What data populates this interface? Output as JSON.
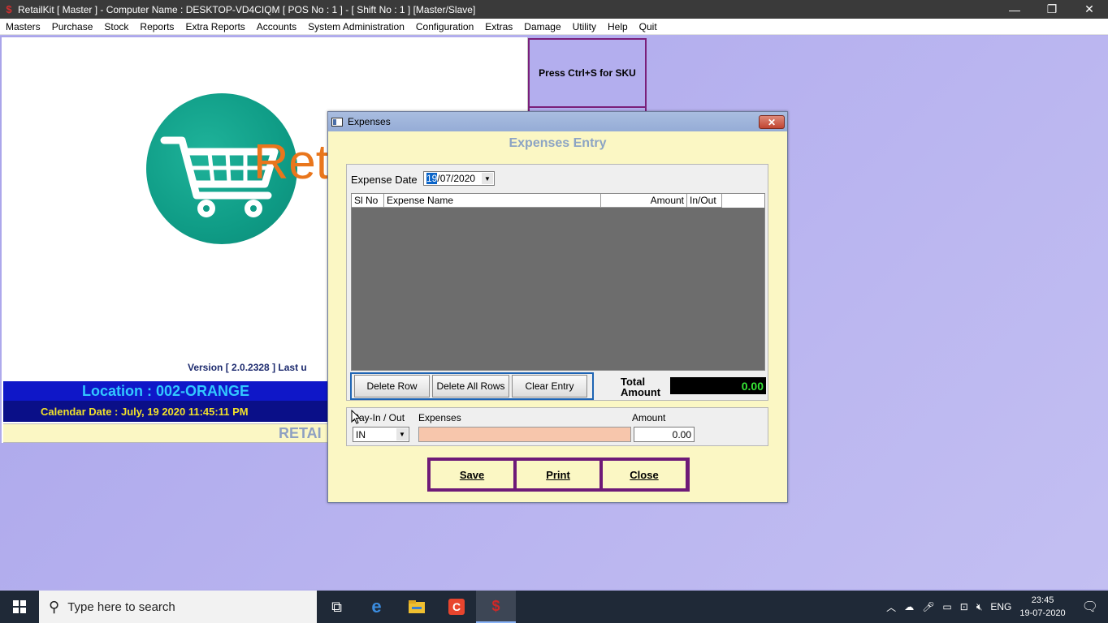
{
  "window": {
    "title": "RetailKit [ Master ] - Computer Name : DESKTOP-VD4CIQM [ POS No : 1 ] - [ Shift No : 1 ]  [Master/Slave]",
    "app_icon": "$",
    "minimize": "—",
    "restore": "❐",
    "close": "✕"
  },
  "menu": [
    "Masters",
    "Purchase",
    "Stock",
    "Reports",
    "Extra Reports",
    "Accounts",
    "System Administration",
    "Configuration",
    "Extras",
    "Damage",
    "Utility",
    "Help",
    "Quit"
  ],
  "home": {
    "logo_text": "Ret",
    "version_text": "Version [ 2.0.2328 ]  Last u",
    "location": "Location : 002-ORANGE",
    "calendar": "Calendar Date : July, 19 2020 11:45:11 PM",
    "retail_label": "RETAI",
    "sku_hint": "Press Ctrl+S for SKU"
  },
  "dialog": {
    "title": "Expenses",
    "close_label": "✕",
    "heading": "Expenses Entry",
    "expense_date_label": "Expense Date",
    "date_selected": "19",
    "date_rest": "/07/2020",
    "grid_columns": [
      "Sl No",
      "Expense Name",
      "Amount",
      "In/Out"
    ],
    "buttons": {
      "delete_row": "Delete Row",
      "delete_all_rows": "Delete All Rows",
      "clear_entry": "Clear Entry"
    },
    "total_label": "Total Amount",
    "total_value": "0.00",
    "pay_label": "Pay-In / Out",
    "expenses_label": "Expenses",
    "amount_label": "Amount",
    "pay_value": "IN",
    "amount_value": "0.00",
    "actions": {
      "save": "Save",
      "print": "Print",
      "close": "Close"
    }
  },
  "taskbar": {
    "search_placeholder": "Type here to search",
    "icons": [
      "task-view-icon",
      "edge-icon",
      "file-explorer-icon",
      "app-c-icon",
      "retailkit-icon"
    ],
    "lang": "ENG",
    "time": "23:45",
    "date": "19-07-2020"
  }
}
